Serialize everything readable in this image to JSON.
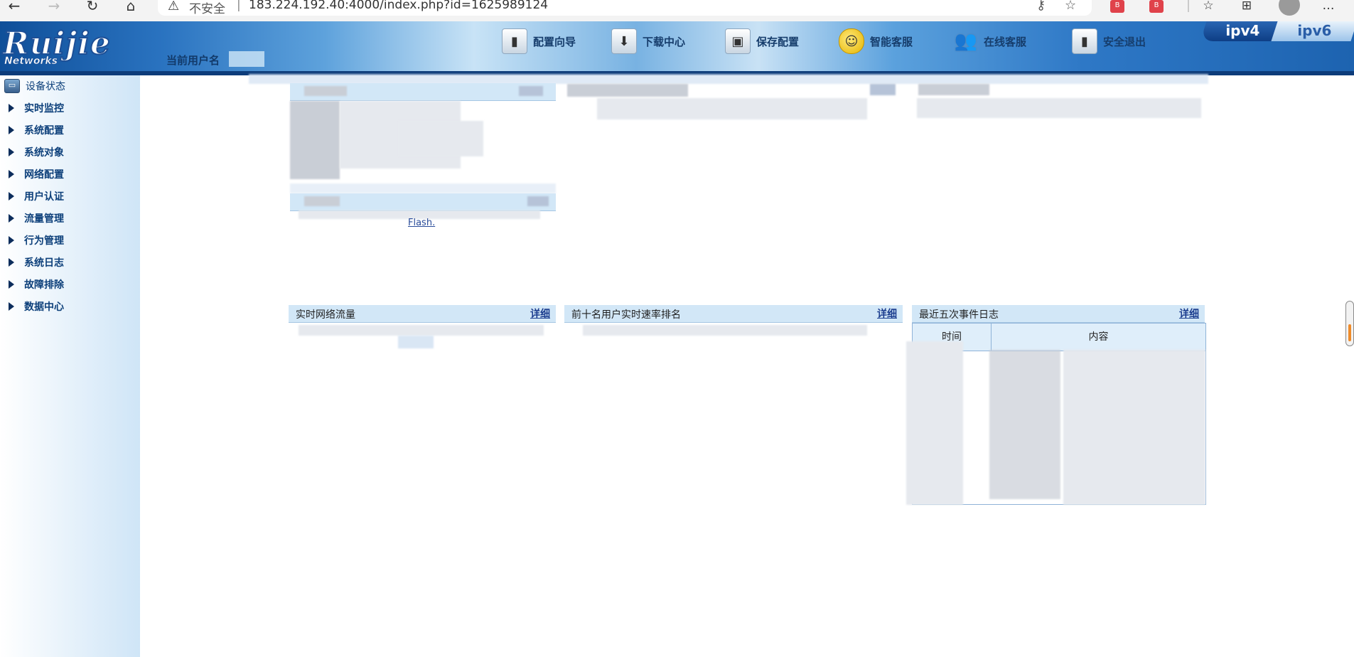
{
  "browser": {
    "security_label": "不安全",
    "separator": "|",
    "url": "183.224.192.40:4000/index.php?id=1625989124",
    "ext_label": "B"
  },
  "header": {
    "logo_big": "Ruijie",
    "logo_small": "Networks",
    "user_label": "当前用户名",
    "nav": [
      {
        "label": "配置向导",
        "icon": "door-icon"
      },
      {
        "label": "下载中心",
        "icon": "download-icon"
      },
      {
        "label": "保存配置",
        "icon": "save-icon"
      },
      {
        "label": "智能客服",
        "icon": "smile-icon"
      },
      {
        "label": "在线客服",
        "icon": "people-icon"
      },
      {
        "label": "安全退出",
        "icon": "exit-icon"
      }
    ],
    "ip_tabs": [
      "ipv4",
      "ipv6"
    ]
  },
  "sidebar": {
    "items": [
      {
        "label": "设备状态"
      },
      {
        "label": "实时监控"
      },
      {
        "label": "系统配置"
      },
      {
        "label": "系统对象"
      },
      {
        "label": "网络配置"
      },
      {
        "label": "用户认证"
      },
      {
        "label": "流量管理"
      },
      {
        "label": "行为管理"
      },
      {
        "label": "系统日志"
      },
      {
        "label": "故障排除"
      },
      {
        "label": "数据中心"
      }
    ]
  },
  "content": {
    "flash_link": "Flash.",
    "panels": [
      {
        "title": "实时网络流量",
        "more": "详细"
      },
      {
        "title": "前十名用户实时速率排名",
        "more": "详细"
      },
      {
        "title": "最近五次事件日志",
        "more": "详细"
      }
    ],
    "log_table": {
      "col_time": "时间",
      "col_content": "内容"
    }
  }
}
